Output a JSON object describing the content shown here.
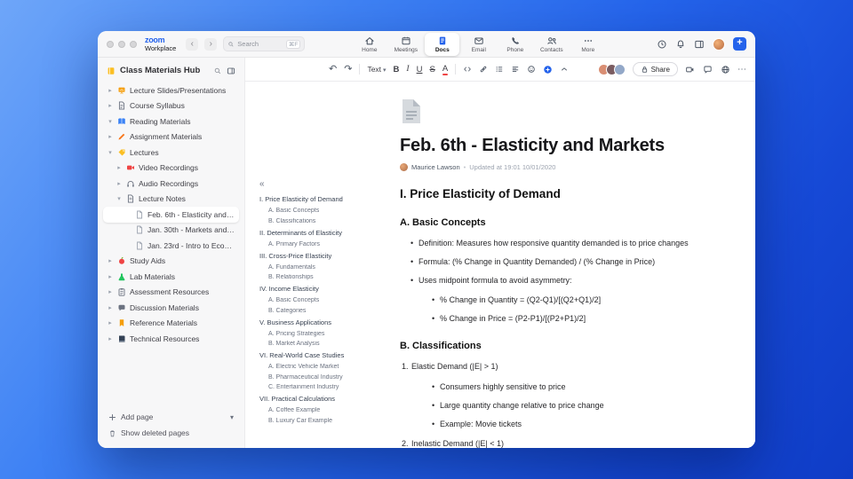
{
  "window": {
    "logo_zoom": "zoom",
    "logo_workplace": "Workplace",
    "search": {
      "placeholder": "Search",
      "shortcut": "⌘F"
    },
    "tabs": [
      {
        "label": "Home",
        "icon": "home-icon",
        "active": false
      },
      {
        "label": "Meetings",
        "icon": "calendar-icon",
        "active": false
      },
      {
        "label": "Docs",
        "icon": "docs-icon",
        "active": true
      },
      {
        "label": "Email",
        "icon": "email-icon",
        "active": false
      },
      {
        "label": "Phone",
        "icon": "phone-icon",
        "active": false
      },
      {
        "label": "Contacts",
        "icon": "contacts-icon",
        "active": false
      },
      {
        "label": "More",
        "icon": "more-icon",
        "active": false
      }
    ]
  },
  "sidebar": {
    "title": "Class Materials Hub",
    "items": [
      {
        "label": "Lecture Slides/Presentations",
        "icon": "slides-icon",
        "depth": 0,
        "chevron": "right",
        "selected": false
      },
      {
        "label": "Course Syllabus",
        "icon": "syllabus-icon",
        "depth": 0,
        "chevron": "right",
        "selected": false
      },
      {
        "label": "Reading Materials",
        "icon": "reading-icon",
        "depth": 0,
        "chevron": "down",
        "selected": false
      },
      {
        "label": "Assignment Materials",
        "icon": "assignment-icon",
        "depth": 0,
        "chevron": "right",
        "selected": false
      },
      {
        "label": "Lectures",
        "icon": "lectures-icon",
        "depth": 0,
        "chevron": "down",
        "selected": false
      },
      {
        "label": "Video Recordings",
        "icon": "video-icon",
        "depth": 1,
        "chevron": "right",
        "selected": false
      },
      {
        "label": "Audio Recordings",
        "icon": "audio-icon",
        "depth": 1,
        "chevron": "right",
        "selected": false
      },
      {
        "label": "Lecture Notes",
        "icon": "notes-icon",
        "depth": 1,
        "chevron": "down",
        "selected": false
      },
      {
        "label": "Feb. 6th - Elasticity and M...",
        "icon": "doc-icon",
        "depth": 2,
        "chevron": null,
        "selected": true
      },
      {
        "label": "Jan. 30th - Markets and P...",
        "icon": "doc-icon",
        "depth": 2,
        "chevron": null,
        "selected": false
      },
      {
        "label": "Jan. 23rd - Intro to Econo...",
        "icon": "doc-icon",
        "depth": 2,
        "chevron": null,
        "selected": false
      },
      {
        "label": "Study Aids",
        "icon": "study-icon",
        "depth": 0,
        "chevron": "right",
        "selected": false
      },
      {
        "label": "Lab Materials",
        "icon": "lab-icon",
        "depth": 0,
        "chevron": "right",
        "selected": false
      },
      {
        "label": "Assessment Resources",
        "icon": "assessment-icon",
        "depth": 0,
        "chevron": "right",
        "selected": false
      },
      {
        "label": "Discussion Materials",
        "icon": "discussion-icon",
        "depth": 0,
        "chevron": "right",
        "selected": false
      },
      {
        "label": "Reference Materials",
        "icon": "reference-icon",
        "depth": 0,
        "chevron": "right",
        "selected": false
      },
      {
        "label": "Technical Resources",
        "icon": "technical-icon",
        "depth": 0,
        "chevron": "right",
        "selected": false
      }
    ],
    "footer": {
      "add_page": "Add page",
      "show_deleted": "Show deleted pages"
    }
  },
  "toolbar": {
    "text_style_label": "Text",
    "format_buttons": [
      {
        "name": "bold-button",
        "glyph": "B",
        "style": "bold"
      },
      {
        "name": "italic-button",
        "glyph": "I",
        "style": "italic"
      },
      {
        "name": "underline-button",
        "glyph": "U",
        "style": "underline"
      },
      {
        "name": "strikethrough-button",
        "glyph": "S",
        "style": "strike"
      },
      {
        "name": "font-color-button",
        "glyph": "A",
        "style": "fontcolor"
      }
    ],
    "icon_buttons": [
      "code-icon",
      "link-icon",
      "bullet-list-icon",
      "align-icon",
      "emoji-icon"
    ],
    "avatars": [
      "#d98e73",
      "#7a5c61",
      "#93a8c8"
    ],
    "share_label": "Share",
    "right_icons": [
      "video-camera-icon",
      "comment-icon",
      "globe-icon"
    ],
    "accent_color": "#2563eb"
  },
  "document": {
    "title": "Feb. 6th - Elasticity and Markets",
    "author": "Maurice Lawson",
    "updated": "Updated at 19:01 10/01/2020",
    "outline": [
      {
        "label": "I. Price Elasticity of Demand",
        "level": 1
      },
      {
        "label": "A. Basic Concepts",
        "level": 2
      },
      {
        "label": "B. Classifications",
        "level": 2
      },
      {
        "label": "II. Determinants of Elasticity",
        "level": 1
      },
      {
        "label": "A. Primary Factors",
        "level": 2
      },
      {
        "label": "III. Cross-Price Elasticity",
        "level": 1
      },
      {
        "label": "A. Fundamentals",
        "level": 2
      },
      {
        "label": "B. Relationships",
        "level": 2
      },
      {
        "label": "IV. Income Elasticity",
        "level": 1
      },
      {
        "label": "A. Basic Concepts",
        "level": 2
      },
      {
        "label": "B. Categories",
        "level": 2
      },
      {
        "label": "V. Business Applications",
        "level": 1
      },
      {
        "label": "A. Pricing Strategies",
        "level": 2
      },
      {
        "label": "B. Market Analysis",
        "level": 2
      },
      {
        "label": "VI. Real-World Case Studies",
        "level": 1
      },
      {
        "label": "A. Electric Vehicle Market",
        "level": 2
      },
      {
        "label": "B. Pharmaceutical Industry",
        "level": 2
      },
      {
        "label": "C. Entertainment Industry",
        "level": 2
      },
      {
        "label": "VII. Practical Calculations",
        "level": 1
      },
      {
        "label": "A. Coffee Example",
        "level": 2
      },
      {
        "label": "B. Luxury Car Example",
        "level": 2
      }
    ],
    "content": {
      "blocks": [
        {
          "type": "h2",
          "text": "I. Price Elasticity of Demand"
        },
        {
          "type": "h3",
          "text": "A. Basic Concepts"
        },
        {
          "type": "bullet",
          "depth": 0,
          "text": "Definition: Measures how responsive quantity demanded is to price changes"
        },
        {
          "type": "bullet",
          "depth": 0,
          "text": "Formula: (% Change in Quantity Demanded) / (% Change in Price)"
        },
        {
          "type": "bullet",
          "depth": 0,
          "text": "Uses midpoint formula to avoid asymmetry:"
        },
        {
          "type": "bullet",
          "depth": 1,
          "text": "% Change in Quantity = (Q2-Q1)/[(Q2+Q1)/2]"
        },
        {
          "type": "bullet",
          "depth": 1,
          "text": "% Change in Price = (P2-P1)/[(P2+P1)/2]"
        },
        {
          "type": "h3",
          "text": "B. Classifications"
        },
        {
          "type": "numbered",
          "marker": "1.",
          "text": "Elastic Demand (|E| > 1)"
        },
        {
          "type": "bullet",
          "depth": 1,
          "text": "Consumers highly sensitive to price"
        },
        {
          "type": "bullet",
          "depth": 1,
          "text": "Large quantity change relative to price change"
        },
        {
          "type": "bullet",
          "depth": 1,
          "text": "Example: Movie tickets"
        },
        {
          "type": "numbered",
          "marker": "2.",
          "text": "Inelastic Demand (|E| < 1)"
        }
      ]
    }
  }
}
